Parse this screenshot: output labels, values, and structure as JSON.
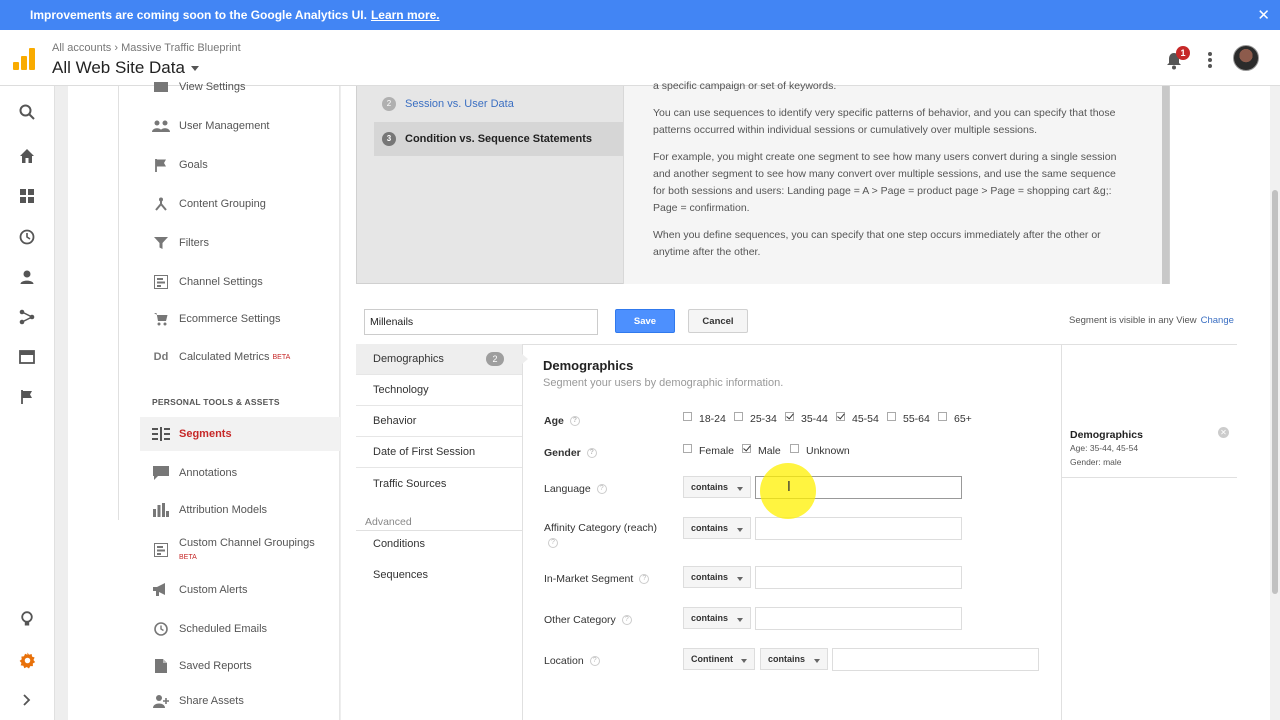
{
  "banner": {
    "text": "Improvements are coming soon to the Google Analytics UI.",
    "link": "Learn more.",
    "close": "✕"
  },
  "header": {
    "breadcrumb_account": "All accounts",
    "breadcrumb_sep": "›",
    "breadcrumb_property": "Massive Traffic Blueprint",
    "view_name": "All Web Site Data",
    "notification_count": "1"
  },
  "admin": {
    "items": [
      {
        "label": "View Settings"
      },
      {
        "label": "User Management"
      },
      {
        "label": "Goals"
      },
      {
        "label": "Content Grouping"
      },
      {
        "label": "Filters"
      },
      {
        "label": "Channel Settings"
      },
      {
        "label": "Ecommerce Settings"
      },
      {
        "label": "Calculated Metrics",
        "badge": "BETA"
      }
    ],
    "section_title": "PERSONAL TOOLS & ASSETS",
    "tools": [
      {
        "label": "Segments"
      },
      {
        "label": "Annotations"
      },
      {
        "label": "Attribution Models"
      },
      {
        "label": "Custom Channel Groupings",
        "badge": "BETA"
      },
      {
        "label": "Custom Alerts"
      },
      {
        "label": "Scheduled Emails"
      },
      {
        "label": "Saved Reports"
      },
      {
        "label": "Share Assets"
      }
    ]
  },
  "tutorial": {
    "steps": [
      {
        "num": "2",
        "label": "Session vs. User Data"
      },
      {
        "num": "3",
        "label": "Condition vs. Sequence Statements"
      }
    ],
    "paragraphs": [
      "a specific campaign or set of keywords.",
      "You can use sequences to identify very specific patterns of behavior, and you can specify that those patterns occurred within individual sessions or cumulatively over multiple sessions.",
      "For example, you might create one segment to see how many users convert during a single session and another segment to see how many convert over multiple sessions, and use the same sequence for both sessions and users: Landing page = A > Page = product page > Page = shopping cart &g;: Page = confirmation.",
      "When you define sequences, you can specify that one step occurs immediately after the other or anytime after the other."
    ]
  },
  "segment": {
    "name": "Millenails",
    "save": "Save",
    "cancel": "Cancel",
    "visibility_text": "Segment is visible in any View",
    "change": "Change"
  },
  "categories": [
    {
      "label": "Demographics",
      "count": "2"
    },
    {
      "label": "Technology"
    },
    {
      "label": "Behavior"
    },
    {
      "label": "Date of First Session"
    },
    {
      "label": "Traffic Sources"
    }
  ],
  "advanced": {
    "heading": "Advanced",
    "items": [
      "Conditions",
      "Sequences"
    ]
  },
  "form": {
    "title": "Demographics",
    "subtitle": "Segment your users by demographic information.",
    "age": {
      "label": "Age",
      "options": [
        {
          "label": "18-24",
          "checked": false
        },
        {
          "label": "25-34",
          "checked": false
        },
        {
          "label": "35-44",
          "checked": true
        },
        {
          "label": "45-54",
          "checked": true
        },
        {
          "label": "55-64",
          "checked": false
        },
        {
          "label": "65+",
          "checked": false
        }
      ]
    },
    "gender": {
      "label": "Gender",
      "options": [
        {
          "label": "Female",
          "checked": false
        },
        {
          "label": "Male",
          "checked": true
        },
        {
          "label": "Unknown",
          "checked": false
        }
      ]
    },
    "language": {
      "label": "Language",
      "operator": "contains",
      "value": ""
    },
    "affinity": {
      "label": "Affinity Category (reach)",
      "operator": "contains",
      "value": ""
    },
    "in_market": {
      "label": "In-Market Segment",
      "operator": "contains",
      "value": ""
    },
    "other": {
      "label": "Other Category",
      "operator": "contains",
      "value": ""
    },
    "location": {
      "label": "Location",
      "scope": "Continent",
      "operator": "contains",
      "value": ""
    }
  },
  "summary": {
    "title": "Demographics",
    "age_line": "Age: 35-44, 45-54",
    "gender_line": "Gender: male"
  },
  "colors": {
    "brand_blue": "#4285f4",
    "accent_red": "#c62828",
    "logo_orange": "#f9ab00",
    "save_blue": "#4d90fe",
    "link_blue": "#3b6fc2"
  }
}
